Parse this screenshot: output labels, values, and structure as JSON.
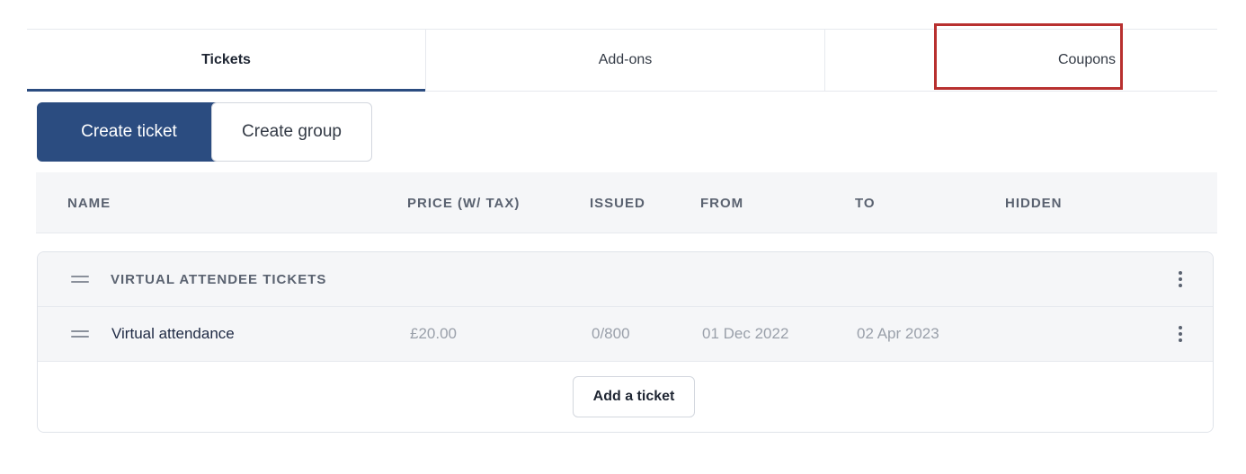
{
  "tabs": [
    {
      "label": "Tickets",
      "active": true
    },
    {
      "label": "Add-ons",
      "active": false
    },
    {
      "label": "Coupons",
      "active": false
    }
  ],
  "actions": {
    "create_ticket": "Create ticket",
    "create_group": "Create group"
  },
  "table": {
    "columns": [
      "NAME",
      "PRICE (W/ TAX)",
      "ISSUED",
      "FROM",
      "TO",
      "HIDDEN"
    ],
    "group": {
      "name": "VIRTUAL ATTENDEE TICKETS",
      "tickets": [
        {
          "name": "Virtual attendance",
          "price": "£20.00",
          "issued": "0/800",
          "from": "01 Dec 2022",
          "to": "02 Apr 2023",
          "hidden": ""
        }
      ]
    },
    "add_ticket_label": "Add a ticket"
  },
  "colors": {
    "primary": "#2b4c80",
    "highlight": "#b8302f",
    "muted_text": "#9aa0aa",
    "header_bg": "#f5f6f8"
  },
  "icons": {
    "drag_handle": "drag-handle-icon",
    "more": "more-vertical-icon"
  }
}
